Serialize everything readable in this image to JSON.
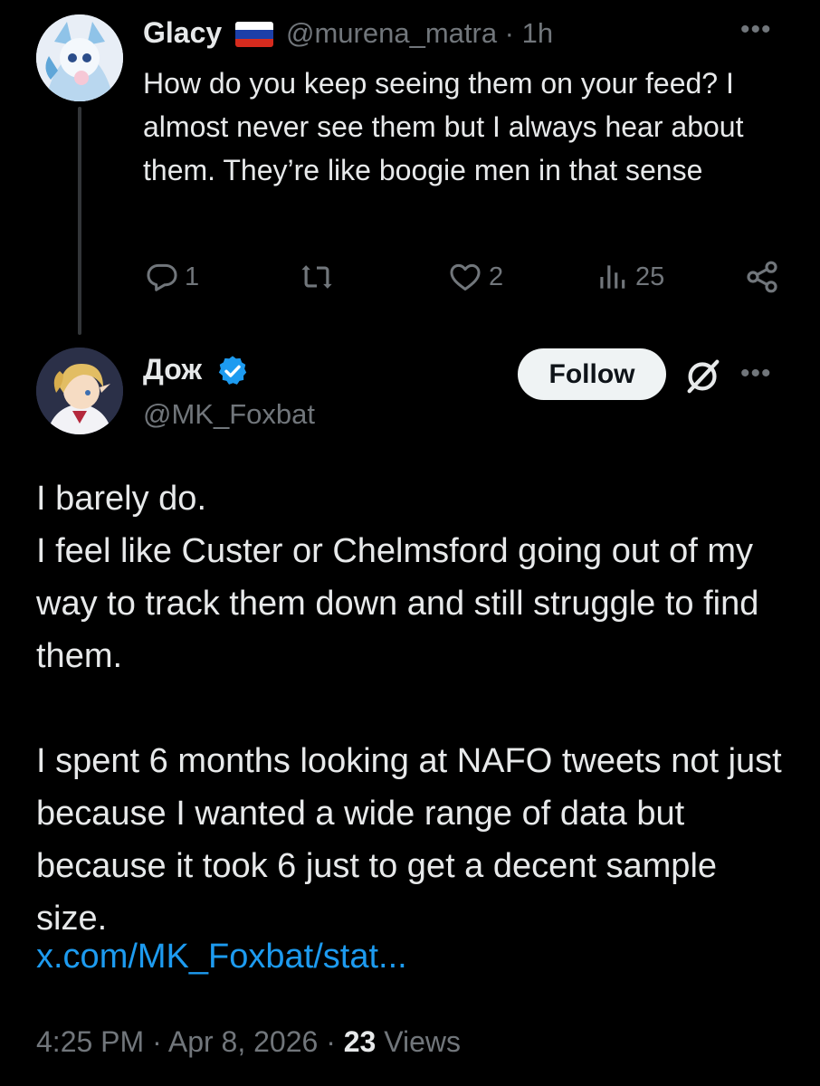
{
  "reply": {
    "display_name": "Glacy",
    "flag_icon": "russia-flag-icon",
    "handle_time": "@murena_matra · 1h",
    "text": "How do you keep seeing them on your feed? I almost never see them but I always hear about them. They’re like boogie men in that sense",
    "actions": {
      "reply_count": "1",
      "repost_count": "",
      "like_count": "2",
      "view_count": "25"
    }
  },
  "main": {
    "display_name": "Дож",
    "handle": "@MK_Foxbat",
    "follow_label": "Follow",
    "text": "I barely do.\nI feel like Custer or Chelmsford going out of my way to track them down and still struggle to find them.\n\nI spent 6 months looking at NAFO tweets not just because I wanted a wide range of data but because it took 6 just to get a decent sample size.",
    "link": "x.com/MK_Foxbat/stat...",
    "timestamp": "4:25 PM · Apr 8, 2026 · ",
    "views_count": "23",
    "views_label": " Views"
  },
  "colors": {
    "background": "#000000",
    "text_primary": "#e7e9ea",
    "text_secondary": "#71767b",
    "link": "#1d9bf0",
    "verified": "#1d9bf0"
  }
}
